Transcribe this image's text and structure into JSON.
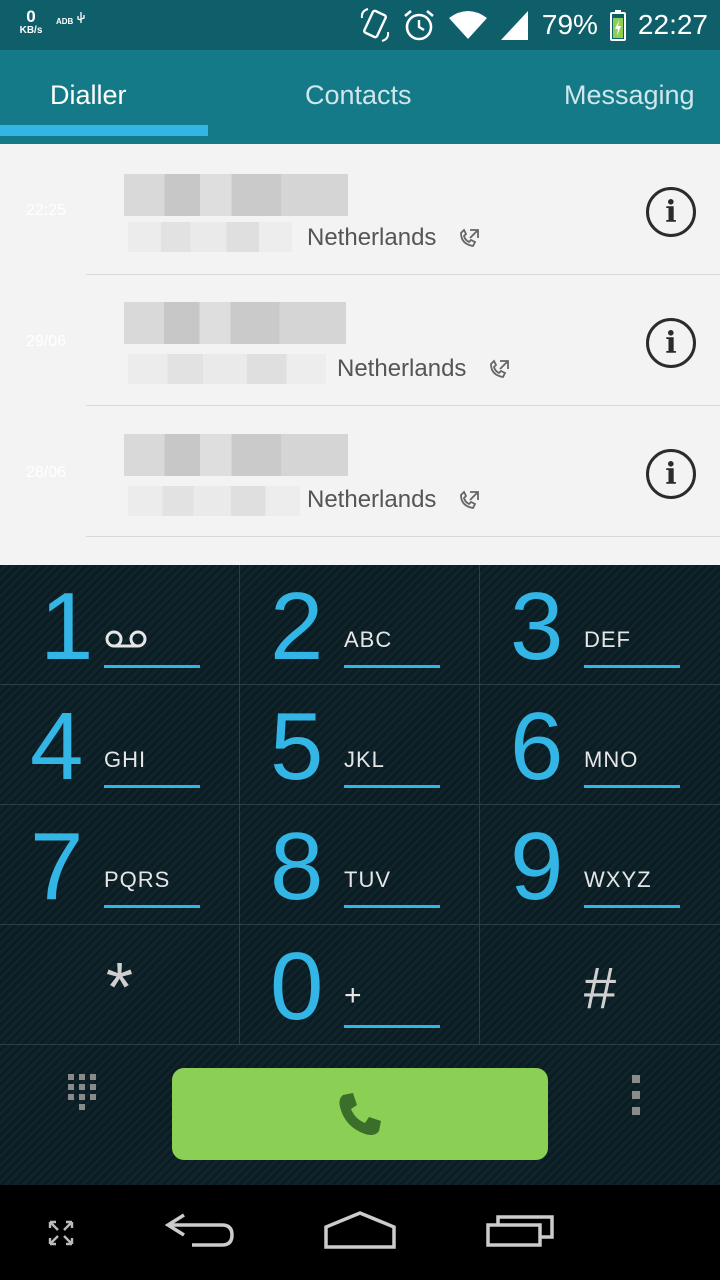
{
  "status_bar": {
    "net_speed_value": "0",
    "net_speed_unit": "KB/s",
    "adb_label": "ADB",
    "icons": [
      "rotation-icon",
      "alarm-icon",
      "wifi-icon",
      "signal-icon",
      "battery-charging-icon"
    ],
    "battery_percent": "79%",
    "time": "22:27"
  },
  "tabs": [
    {
      "label": "Dialler",
      "active": true
    },
    {
      "label": "Contacts",
      "active": false
    },
    {
      "label": "Messaging",
      "active": false
    }
  ],
  "call_log": [
    {
      "date": "22:25",
      "country": "Netherlands",
      "call_type_icon": "outgoing-call-icon",
      "info_icon": "i"
    },
    {
      "date": "29/06",
      "country": "Netherlands",
      "call_type_icon": "outgoing-call-icon",
      "info_icon": "i"
    },
    {
      "date": "28/06",
      "country": "Netherlands",
      "call_type_icon": "outgoing-call-icon",
      "info_icon": "i"
    }
  ],
  "dialpad": {
    "keys": [
      {
        "digit": "1",
        "letters": "",
        "icon": "voicemail-icon"
      },
      {
        "digit": "2",
        "letters": "ABC"
      },
      {
        "digit": "3",
        "letters": "DEF"
      },
      {
        "digit": "4",
        "letters": "GHI"
      },
      {
        "digit": "5",
        "letters": "JKL"
      },
      {
        "digit": "6",
        "letters": "MNO"
      },
      {
        "digit": "7",
        "letters": "PQRS"
      },
      {
        "digit": "8",
        "letters": "TUV"
      },
      {
        "digit": "9",
        "letters": "WXYZ"
      },
      {
        "symbol": "*"
      },
      {
        "digit": "0",
        "letters": "+"
      },
      {
        "symbol": "#"
      }
    ],
    "colors": {
      "digit": "#33b5e5",
      "call_button": "#8bcf55"
    }
  },
  "nav_bar": {
    "icons": [
      "expand-icon",
      "back-icon",
      "home-icon",
      "recent-apps-icon"
    ]
  }
}
